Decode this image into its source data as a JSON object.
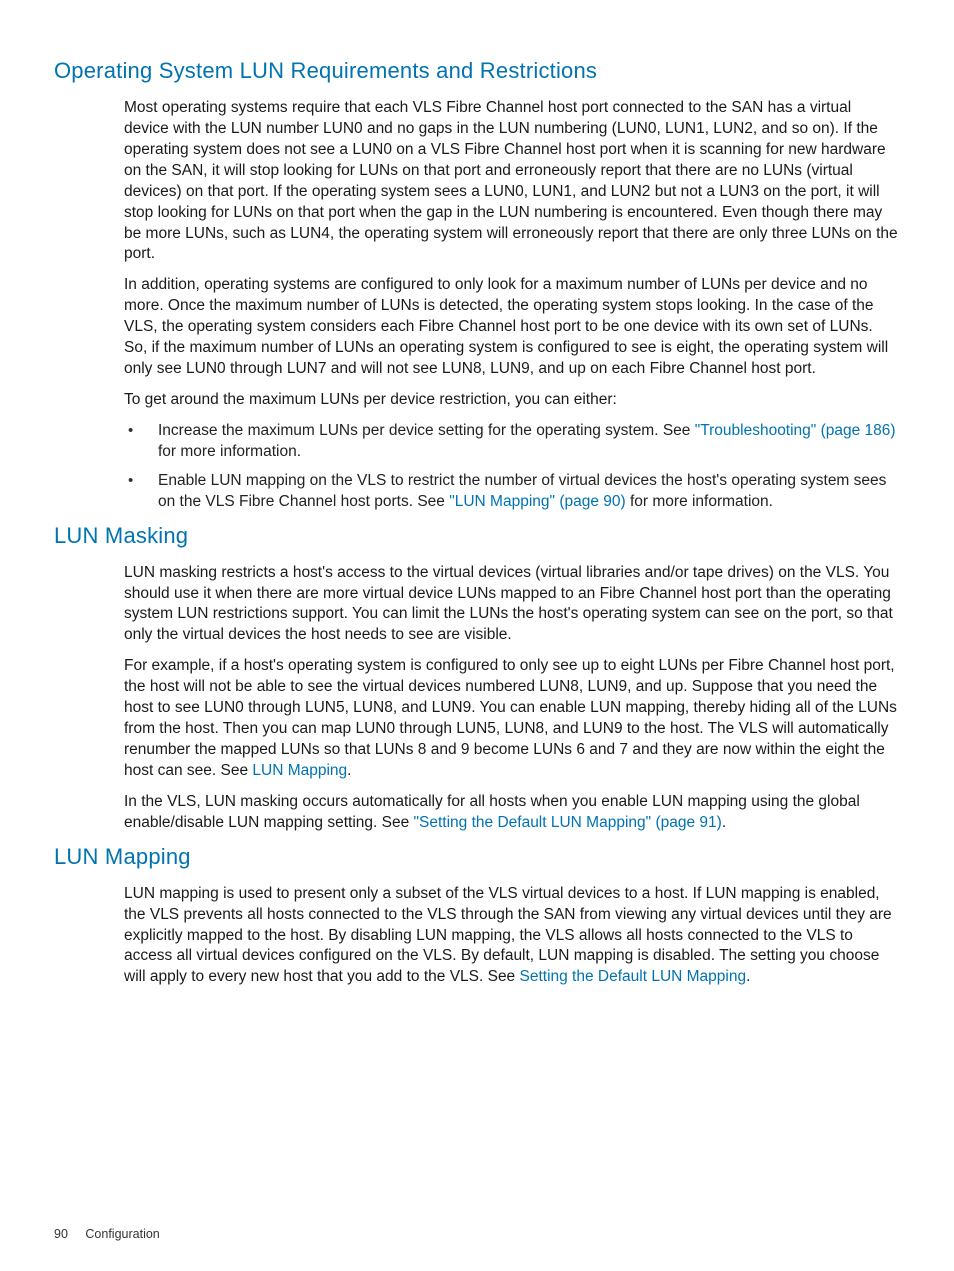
{
  "sections": {
    "s1": {
      "heading": "Operating System LUN Requirements and Restrictions",
      "p1": "Most operating systems require that each VLS Fibre Channel host port connected to the SAN has a virtual device with the LUN number LUN0 and no gaps in the LUN numbering (LUN0, LUN1, LUN2, and so on). If the operating system does not see a LUN0 on a VLS Fibre Channel host port when it is scanning for new hardware on the SAN, it will stop looking for LUNs on that port and erroneously report that there are no LUNs (virtual devices) on that port. If the operating system sees a LUN0, LUN1, and LUN2 but not a LUN3 on the port, it will stop looking for LUNs on that port when the gap in the LUN numbering is encountered. Even though there may be more LUNs, such as LUN4, the operating system will erroneously report that there are only three LUNs on the port.",
      "p2": "In addition, operating systems are configured to only look for a maximum number of LUNs per device and no more. Once the maximum number of LUNs is detected, the operating system stops looking. In the case of the VLS, the operating system considers each Fibre Channel host port to be one device with its own set of LUNs. So, if the maximum number of LUNs an operating system is configured to see is eight, the operating system will only see LUN0 through LUN7 and will not see LUN8, LUN9, and up on each Fibre Channel host port.",
      "p3": "To get around the maximum LUNs per device restriction, you can either:",
      "li1a": "Increase the maximum LUNs per device setting for the operating system. See ",
      "li1_link": "\"Troubleshooting\" (page 186)",
      "li1b": " for more information.",
      "li2a": "Enable LUN mapping on the VLS to restrict the number of virtual devices the host's operating system sees on the VLS Fibre Channel host ports. See ",
      "li2_link": "\"LUN Mapping\" (page 90)",
      "li2b": " for more information."
    },
    "s2": {
      "heading": "LUN Masking",
      "p1": "LUN masking restricts a host's access to the virtual devices (virtual libraries and/or tape drives) on the VLS. You should use it when there are more virtual device LUNs mapped to an Fibre Channel host port than the operating system LUN restrictions support. You can limit the LUNs the host's operating system can see on the port, so that only the virtual devices the host needs to see are visible.",
      "p2a": "For example, if a host's operating system is configured to only see up to eight LUNs per Fibre Channel host port, the host will not be able to see the virtual devices numbered LUN8, LUN9, and up. Suppose that you need the host to see LUN0 through LUN5, LUN8, and LUN9. You can enable LUN mapping, thereby hiding all of the LUNs from the host. Then you can map LUN0 through LUN5, LUN8, and LUN9 to the host. The VLS will automatically renumber the mapped LUNs so that LUNs 8 and 9 become LUNs 6 and 7 and they are now within the eight the host can see. See ",
      "p2_link": "LUN Mapping",
      "p2b": ".",
      "p3a": "In the VLS, LUN masking occurs automatically for all hosts when you enable LUN mapping using the global enable/disable LUN mapping setting. See ",
      "p3_link": "\"Setting the Default LUN Mapping\" (page 91)",
      "p3b": "."
    },
    "s3": {
      "heading": "LUN Mapping",
      "p1a": "LUN mapping is used to present only a subset of the VLS virtual devices to a host. If LUN mapping is enabled, the VLS prevents all hosts connected to the VLS through the SAN from viewing any virtual devices until they are explicitly mapped to the host. By disabling LUN mapping, the VLS allows all hosts connected to the VLS to access all virtual devices configured on the VLS. By default, LUN mapping is disabled. The setting you choose will apply to every new host that you add to the VLS. See ",
      "p1_link": "Setting the Default LUN Mapping",
      "p1b": "."
    }
  },
  "footer": {
    "page_number": "90",
    "section_label": "Configuration"
  }
}
